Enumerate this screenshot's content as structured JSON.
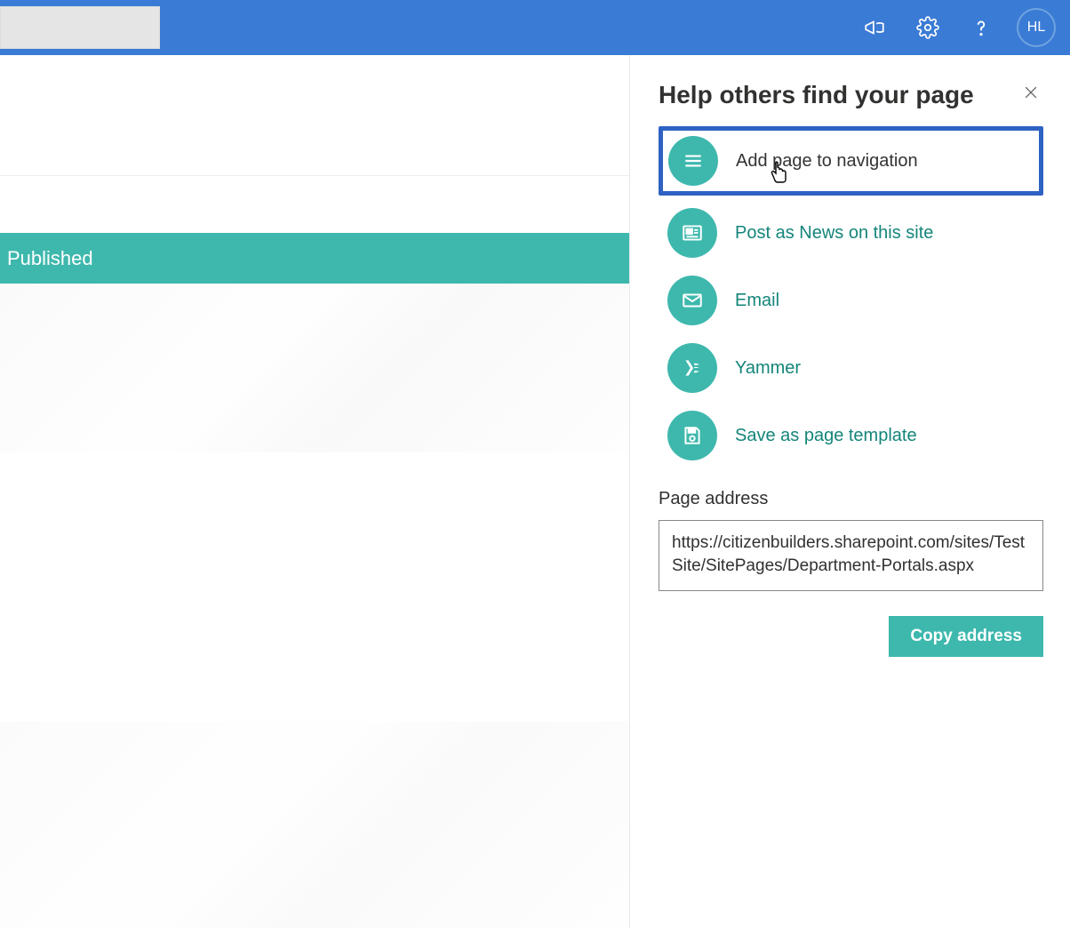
{
  "header": {
    "avatar_initials": "HL"
  },
  "main": {
    "published_label": "Published"
  },
  "panel": {
    "title": "Help others find your page",
    "options": {
      "add_nav": "Add page to navigation",
      "post_news": "Post as News on this site",
      "email": "Email",
      "yammer": "Yammer",
      "save_template": "Save as page template"
    },
    "address_label": "Page address",
    "address_value": "https://citizenbuilders.sharepoint.com/sites/TestSite/SitePages/Department-Portals.aspx",
    "copy_button": "Copy address"
  }
}
